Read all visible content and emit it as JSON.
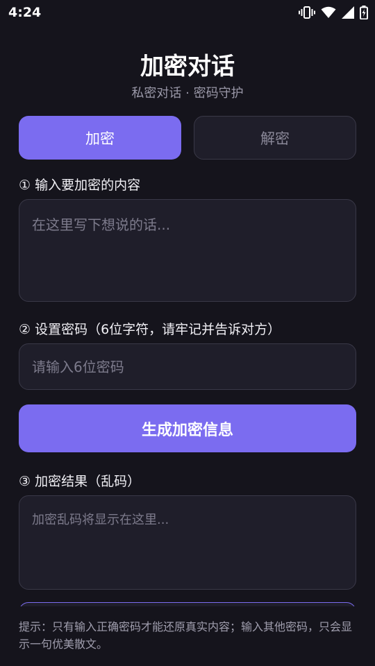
{
  "status_bar": {
    "time": "4:24"
  },
  "header": {
    "title": "加密对话",
    "subtitle": "私密对话 · 密码守护"
  },
  "tabs": [
    {
      "label": "加密",
      "active": true
    },
    {
      "label": "解密",
      "active": false
    }
  ],
  "section_content": {
    "label": "① 输入要加密的内容",
    "placeholder": "在这里写下想说的话..."
  },
  "section_password": {
    "label": "② 设置密码（6位字符，请牢记并告诉对方）",
    "placeholder": "请输入6位密码"
  },
  "generate_button": {
    "label": "生成加密信息"
  },
  "section_result": {
    "label": "③ 加密结果（乱码）",
    "placeholder": "加密乱码将显示在这里..."
  },
  "hint": {
    "text": "提示：只有输入正确密码才能还原真实内容；输入其他密码，只会显示一句优美散文。"
  },
  "colors": {
    "background": "#15141c",
    "accent": "#7b6cf0",
    "surface": "#1f1e2a",
    "border": "#3a3948"
  },
  "icons": [
    "vibrate-icon",
    "wifi-icon",
    "cellular-signal-icon",
    "battery-icon"
  ]
}
